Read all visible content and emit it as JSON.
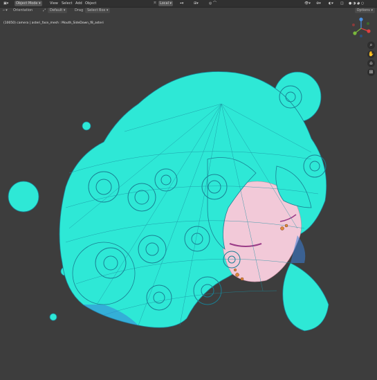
{
  "header": {
    "mode": "Object Mode",
    "menus": [
      "View",
      "Select",
      "Add",
      "Object"
    ],
    "pivot": "Local",
    "options_label": "Options"
  },
  "toolbar": {
    "orientation_label": "Orientation",
    "orientation_value": "Default",
    "drag_label": "Drag",
    "drag_value": "Select Box"
  },
  "overlay": {
    "view_name": "",
    "info": "(10050) camera | asteri_face_mesh : Mouth_SideDown_f8_asteri"
  },
  "colors": {
    "hair": "#2ee8d6",
    "hair_shadow": "#3a7fd8",
    "face": "#f2c9d8",
    "background": "#3d3d3d"
  },
  "icons": [
    "zoom-icon",
    "hand-pan-icon",
    "camera-icon",
    "perspective-grid-icon"
  ]
}
